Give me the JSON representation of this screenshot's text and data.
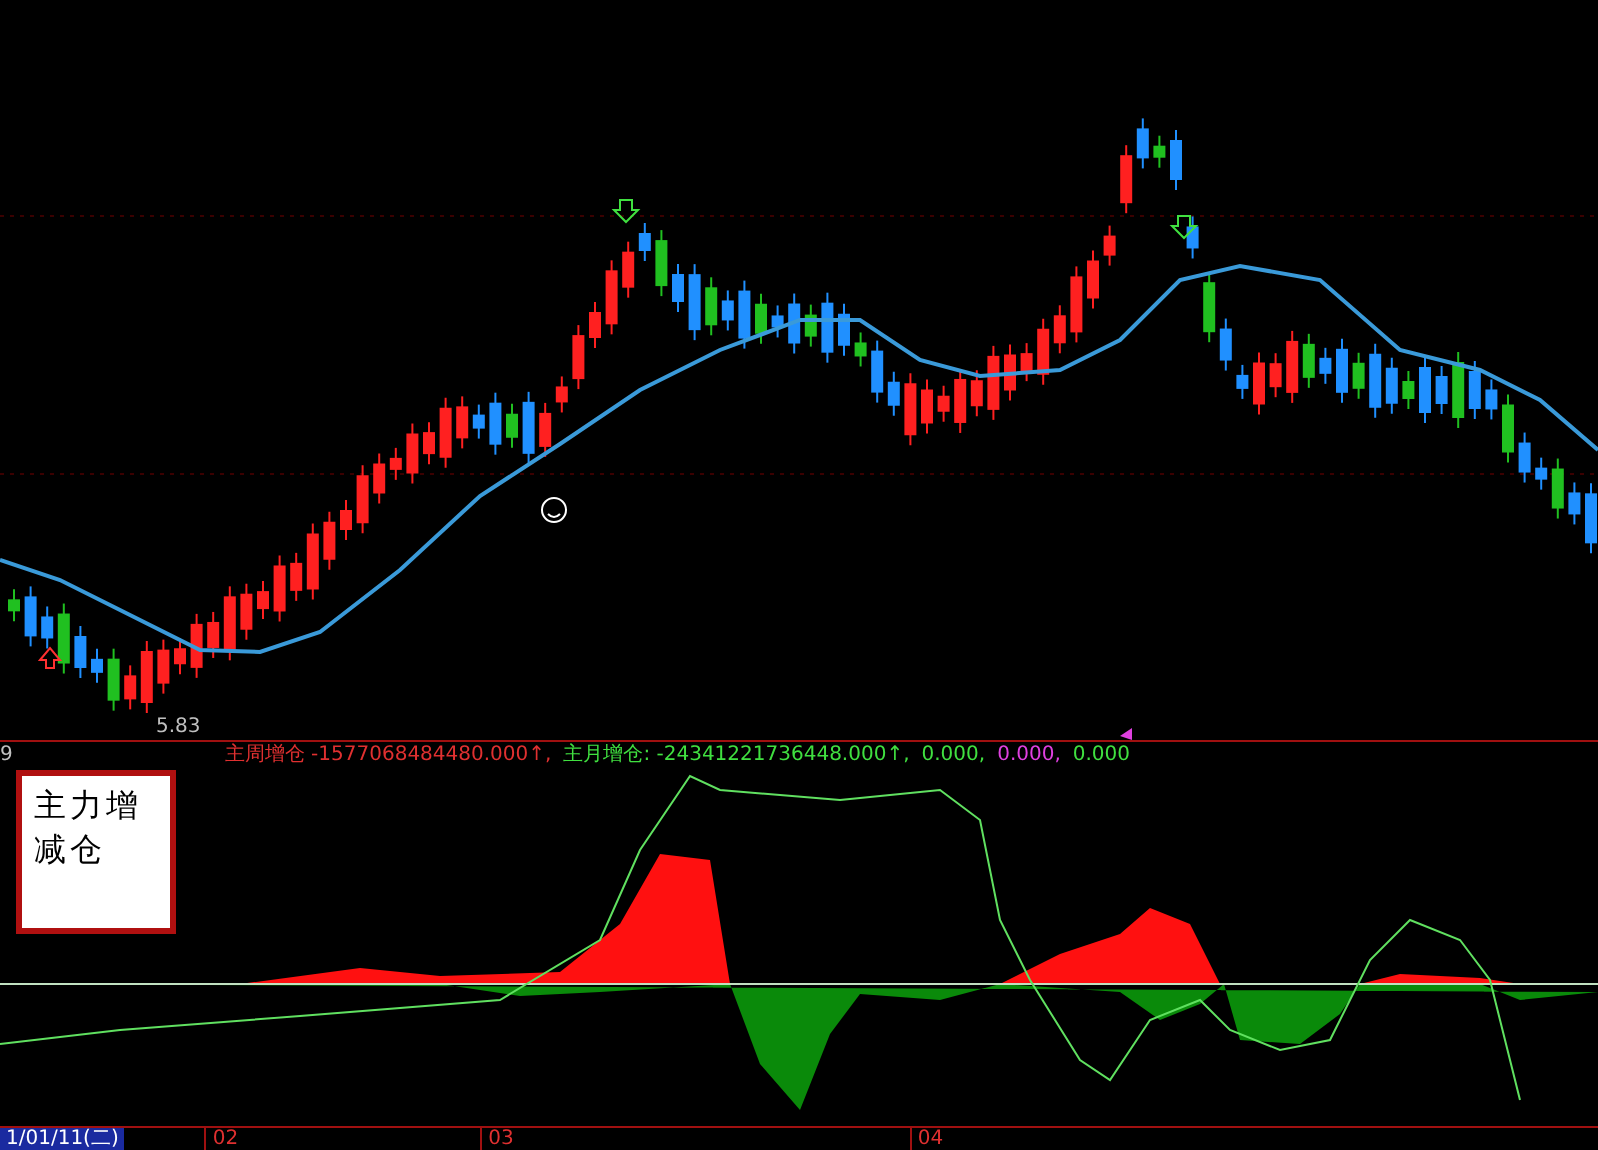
{
  "main_chart": {
    "price_label": "5.83"
  },
  "indicator": {
    "title": "主力增减仓",
    "legend": [
      {
        "text": "9",
        "color": "#c0c0c0"
      },
      {
        "text": "主周增仓  -1577068484480.000↑,",
        "color": "#e03030"
      },
      {
        "text": "主月增仓: -24341221736448.000↑,",
        "color": "#40e040"
      },
      {
        "text": "0.000,",
        "color": "#40e040"
      },
      {
        "text": "0.000,",
        "color": "#e040e0"
      },
      {
        "text": "0.000",
        "color": "#40e040"
      }
    ]
  },
  "time_axis": [
    {
      "text": "1/01/11(二)",
      "selected": true
    },
    {
      "text": "02",
      "selected": false
    },
    {
      "text": "03",
      "selected": false
    },
    {
      "text": "04",
      "selected": false
    }
  ]
}
